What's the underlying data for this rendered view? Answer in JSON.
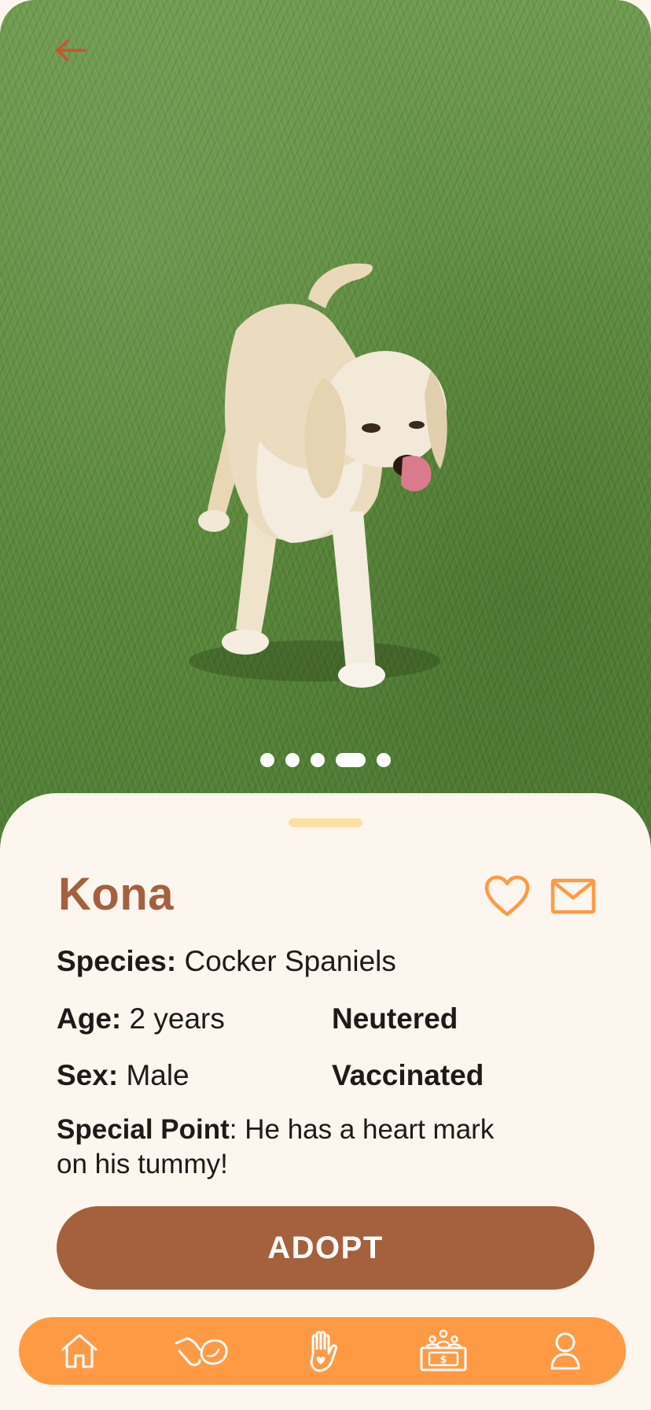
{
  "pet": {
    "name": "Kona",
    "species_label": "Species:",
    "species_value": "Cocker Spaniels",
    "age_label": "Age:",
    "age_value": "2 years",
    "sex_label": "Sex:",
    "sex_value": "Male",
    "tag_neutered": "Neutered",
    "tag_vaccinated": "Vaccinated",
    "special_label": "Special Point",
    "special_value": "He has a heart mark on his tummy!"
  },
  "gallery": {
    "dot_count": 5,
    "active_index": 3
  },
  "actions": {
    "adopt_label": "ADOPT",
    "favorite_icon": "heart-outline-icon",
    "message_icon": "mail-icon"
  },
  "nav": {
    "items": [
      {
        "name": "home",
        "icon": "home-icon"
      },
      {
        "name": "pet-care",
        "icon": "hand-paw-icon"
      },
      {
        "name": "volunteer",
        "icon": "hand-heart-icon"
      },
      {
        "name": "donate",
        "icon": "donation-box-icon"
      },
      {
        "name": "profile",
        "icon": "person-icon"
      }
    ]
  },
  "colors": {
    "accent_brown": "#a5603d",
    "accent_orange": "#ff9a44",
    "sheet_bg": "#fdf6ee",
    "handle": "#fbe0a3",
    "back_arrow": "#c9542f"
  }
}
